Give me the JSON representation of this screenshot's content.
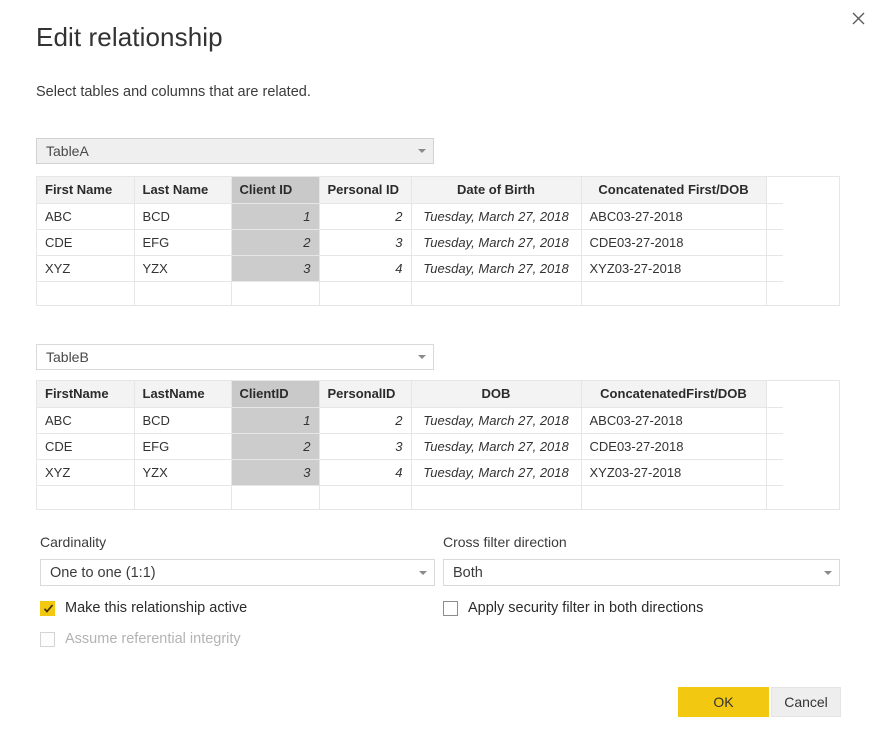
{
  "dialog": {
    "title": "Edit relationship",
    "subtitle": "Select tables and columns that are related.",
    "close_icon": "close-icon",
    "accent_color": "#f2c811",
    "selected_column_color": "#cccccc",
    "header_background": "#f3f3f3"
  },
  "table_a": {
    "selector_value": "TableA",
    "selector_state": "hover",
    "selected_column": "Client ID",
    "columns": [
      {
        "header": "First Name",
        "align": "left",
        "type": "text"
      },
      {
        "header": "Last Name",
        "align": "left",
        "type": "text"
      },
      {
        "header": "Client ID",
        "align": "left",
        "type": "number"
      },
      {
        "header": "Personal ID",
        "align": "left",
        "type": "number"
      },
      {
        "header": "Date of Birth",
        "align": "center",
        "type": "date"
      },
      {
        "header": "Concatenated First/DOB",
        "align": "center",
        "type": "text"
      }
    ],
    "rows": [
      [
        "ABC",
        "BCD",
        "1",
        "2",
        "Tuesday, March 27, 2018",
        "ABC03-27-2018"
      ],
      [
        "CDE",
        "EFG",
        "2",
        "3",
        "Tuesday, March 27, 2018",
        "CDE03-27-2018"
      ],
      [
        "XYZ",
        "YZX",
        "3",
        "4",
        "Tuesday, March 27, 2018",
        "XYZ03-27-2018"
      ]
    ]
  },
  "table_b": {
    "selector_value": "TableB",
    "selector_state": "normal",
    "selected_column": "ClientID",
    "columns": [
      {
        "header": "FirstName",
        "align": "left",
        "type": "text"
      },
      {
        "header": "LastName",
        "align": "left",
        "type": "text"
      },
      {
        "header": "ClientID",
        "align": "left",
        "type": "number"
      },
      {
        "header": "PersonalID",
        "align": "left",
        "type": "number"
      },
      {
        "header": "DOB",
        "align": "center",
        "type": "date"
      },
      {
        "header": "ConcatenatedFirst/DOB",
        "align": "center",
        "type": "text"
      }
    ],
    "rows": [
      [
        "ABC",
        "BCD",
        "1",
        "2",
        "Tuesday, March 27, 2018",
        "ABC03-27-2018"
      ],
      [
        "CDE",
        "EFG",
        "2",
        "3",
        "Tuesday, March 27, 2018",
        "CDE03-27-2018"
      ],
      [
        "XYZ",
        "YZX",
        "3",
        "4",
        "Tuesday, March 27, 2018",
        "XYZ03-27-2018"
      ]
    ]
  },
  "options": {
    "cardinality_label": "Cardinality",
    "cardinality_value": "One to one (1:1)",
    "cross_filter_label": "Cross filter direction",
    "cross_filter_value": "Both",
    "make_active_label": "Make this relationship active",
    "make_active_checked": true,
    "referential_integrity_label": "Assume referential integrity",
    "referential_integrity_checked": false,
    "referential_integrity_disabled": true,
    "security_filter_label": "Apply security filter in both directions",
    "security_filter_checked": false
  },
  "footer": {
    "ok_label": "OK",
    "cancel_label": "Cancel"
  }
}
